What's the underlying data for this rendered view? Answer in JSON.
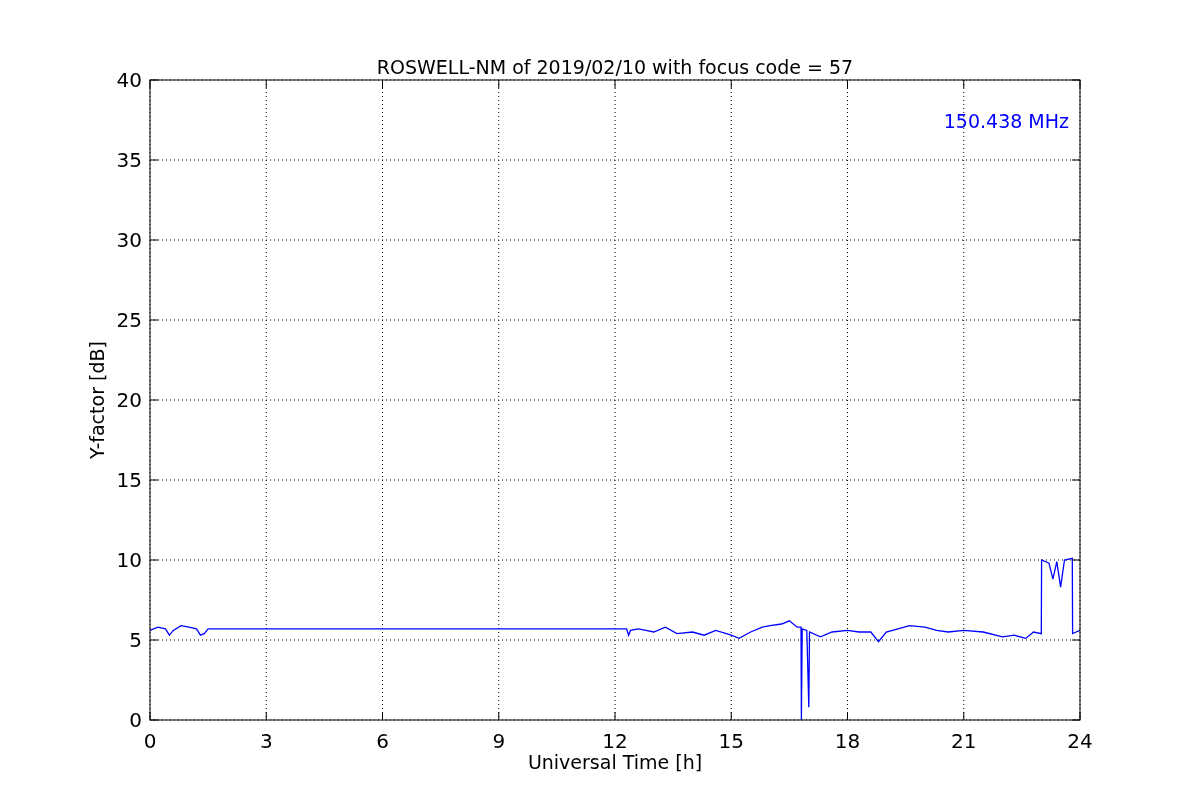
{
  "chart_data": {
    "type": "line",
    "title": "ROSWELL-NM of 2019/02/10 with focus code = 57",
    "xlabel": "Universal Time [h]",
    "ylabel": "Y-factor [dB]",
    "x": [
      0,
      0.2,
      0.4,
      0.5,
      0.6,
      0.8,
      1.0,
      1.2,
      1.3,
      1.4,
      1.5,
      12.3,
      12.35,
      12.4,
      12.6,
      12.8,
      13.0,
      13.3,
      13.6,
      14.0,
      14.3,
      14.6,
      15.0,
      15.2,
      15.5,
      15.8,
      16.0,
      16.3,
      16.5,
      16.7,
      16.8,
      16.81,
      16.83,
      16.95,
      17.0,
      17.02,
      17.3,
      17.6,
      18.0,
      18.3,
      18.6,
      18.8,
      19.0,
      19.3,
      19.6,
      20.0,
      20.3,
      20.6,
      21.0,
      21.5,
      22.0,
      22.3,
      22.6,
      22.8,
      23.0,
      23.01,
      23.2,
      23.3,
      23.4,
      23.5,
      23.6,
      23.8,
      23.81,
      23.9,
      24.0
    ],
    "series": [
      {
        "color": "#0000ff",
        "values": [
          5.6,
          5.8,
          5.7,
          5.3,
          5.6,
          5.9,
          5.8,
          5.7,
          5.3,
          5.4,
          5.7,
          5.7,
          5.3,
          5.6,
          5.7,
          5.6,
          5.5,
          5.8,
          5.4,
          5.5,
          5.3,
          5.6,
          5.3,
          5.1,
          5.5,
          5.8,
          5.9,
          6.0,
          6.2,
          5.8,
          5.8,
          0,
          5.7,
          5.6,
          0.8,
          5.5,
          5.2,
          5.5,
          5.6,
          5.5,
          5.5,
          4.9,
          5.5,
          5.7,
          5.9,
          5.8,
          5.6,
          5.5,
          5.6,
          5.5,
          5.2,
          5.3,
          5.1,
          5.5,
          5.4,
          10.0,
          9.8,
          8.8,
          9.9,
          8.3,
          10.0,
          10.1,
          5.4,
          5.5,
          5.6
        ]
      }
    ],
    "xlim": [
      0,
      24
    ],
    "ylim": [
      0,
      40
    ],
    "xticks": [
      0,
      3,
      6,
      9,
      12,
      15,
      18,
      21,
      24
    ],
    "yticks": [
      0,
      5,
      10,
      15,
      20,
      25,
      30,
      35,
      40
    ],
    "grid": true,
    "annotations": [
      {
        "text": "150.438 MHz"
      }
    ]
  }
}
